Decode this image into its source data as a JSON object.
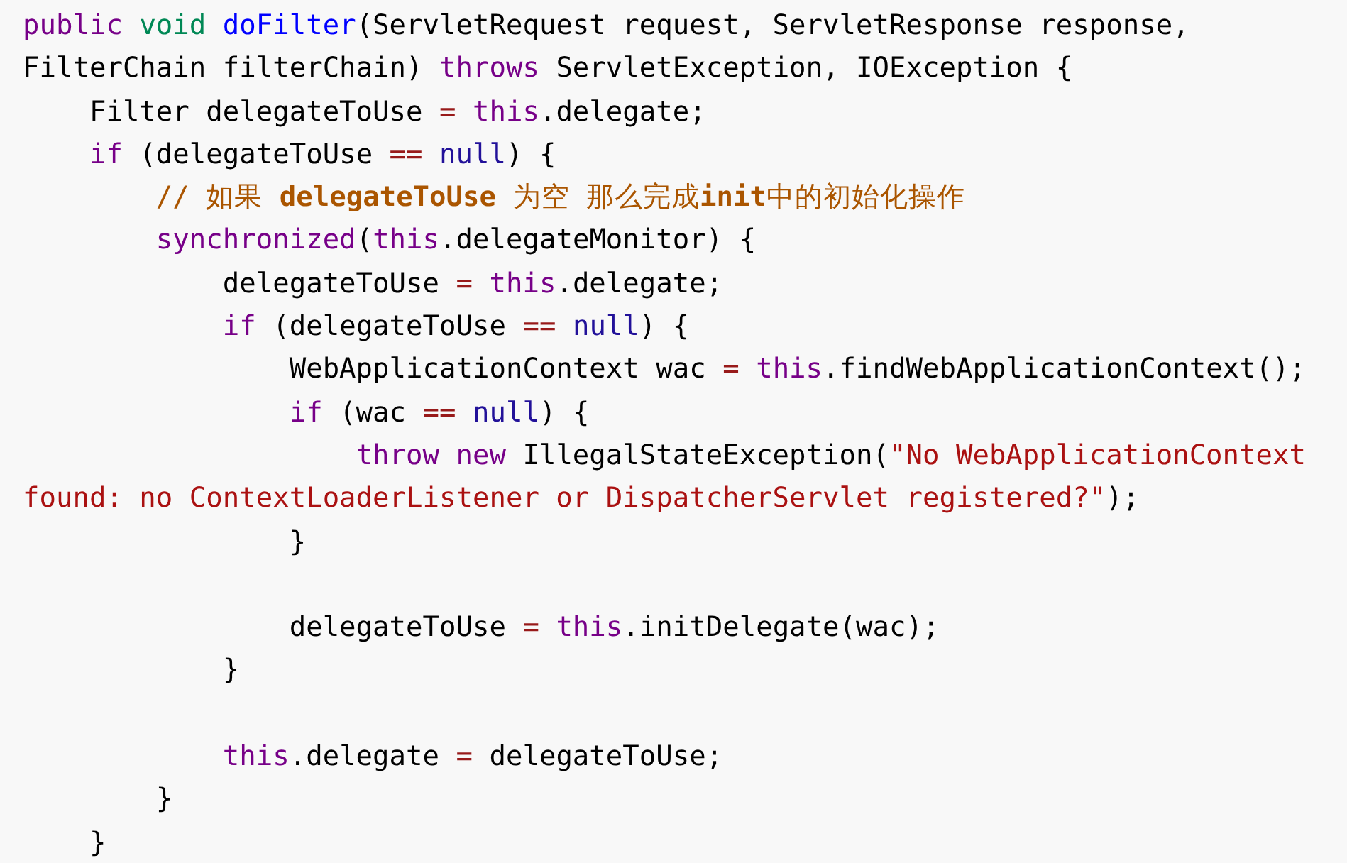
{
  "code_block": {
    "lines": [
      {
        "kind": "code",
        "tokens": [
          {
            "kind": "keyword",
            "text": "public "
          },
          {
            "kind": "type",
            "text": "void "
          },
          {
            "kind": "def",
            "text": "doFilter"
          },
          {
            "kind": "plain",
            "text": "(ServletRequest request, ServletResponse response,"
          }
        ]
      },
      {
        "kind": "code",
        "tokens": [
          {
            "kind": "plain",
            "text": "FilterChain filterChain) "
          },
          {
            "kind": "keyword",
            "text": "throws"
          },
          {
            "kind": "plain",
            "text": " ServletException, IOException {"
          }
        ]
      },
      {
        "kind": "code",
        "tokens": [
          {
            "kind": "plain",
            "text": "    Filter delegateToUse "
          },
          {
            "kind": "operator",
            "text": "= "
          },
          {
            "kind": "keyword",
            "text": "this"
          },
          {
            "kind": "plain",
            "text": ".delegate;"
          }
        ]
      },
      {
        "kind": "code",
        "tokens": [
          {
            "kind": "keyword",
            "text": "    if"
          },
          {
            "kind": "plain",
            "text": " (delegateToUse "
          },
          {
            "kind": "operator",
            "text": "== "
          },
          {
            "kind": "atom",
            "text": "null"
          },
          {
            "kind": "plain",
            "text": ") {"
          }
        ]
      },
      {
        "kind": "code",
        "tokens": [
          {
            "kind": "comment",
            "text": "        // 如果 "
          },
          {
            "kind": "comment-strong",
            "text": "delegateToUse"
          },
          {
            "kind": "comment",
            "text": " 为空 那么完成"
          },
          {
            "kind": "comment-strong",
            "text": "init"
          },
          {
            "kind": "comment",
            "text": "中的初始化操作"
          }
        ]
      },
      {
        "kind": "code",
        "tokens": [
          {
            "kind": "keyword",
            "text": "        synchronized"
          },
          {
            "kind": "plain",
            "text": "("
          },
          {
            "kind": "keyword",
            "text": "this"
          },
          {
            "kind": "plain",
            "text": ".delegateMonitor) {"
          }
        ]
      },
      {
        "kind": "code",
        "tokens": [
          {
            "kind": "plain",
            "text": "            delegateToUse "
          },
          {
            "kind": "operator",
            "text": "= "
          },
          {
            "kind": "keyword",
            "text": "this"
          },
          {
            "kind": "plain",
            "text": ".delegate;"
          }
        ]
      },
      {
        "kind": "code",
        "tokens": [
          {
            "kind": "keyword",
            "text": "            if"
          },
          {
            "kind": "plain",
            "text": " (delegateToUse "
          },
          {
            "kind": "operator",
            "text": "== "
          },
          {
            "kind": "atom",
            "text": "null"
          },
          {
            "kind": "plain",
            "text": ") {"
          }
        ]
      },
      {
        "kind": "code",
        "tokens": [
          {
            "kind": "plain",
            "text": "                WebApplicationContext wac "
          },
          {
            "kind": "operator",
            "text": "= "
          },
          {
            "kind": "keyword",
            "text": "this"
          },
          {
            "kind": "plain",
            "text": ".findWebApplicationContext();"
          }
        ]
      },
      {
        "kind": "code",
        "tokens": [
          {
            "kind": "keyword",
            "text": "                if"
          },
          {
            "kind": "plain",
            "text": " (wac "
          },
          {
            "kind": "operator",
            "text": "== "
          },
          {
            "kind": "atom",
            "text": "null"
          },
          {
            "kind": "plain",
            "text": ") {"
          }
        ]
      },
      {
        "kind": "code",
        "tokens": [
          {
            "kind": "keyword",
            "text": "                    throw new"
          },
          {
            "kind": "plain",
            "text": " IllegalStateException("
          },
          {
            "kind": "string",
            "text": "\"No WebApplicationContext"
          }
        ]
      },
      {
        "kind": "code",
        "tokens": [
          {
            "kind": "string",
            "text": "found: no ContextLoaderListener or DispatcherServlet registered?\""
          },
          {
            "kind": "plain",
            "text": ");"
          }
        ]
      },
      {
        "kind": "code",
        "tokens": [
          {
            "kind": "plain",
            "text": "                }"
          }
        ]
      },
      {
        "kind": "blank"
      },
      {
        "kind": "code",
        "tokens": [
          {
            "kind": "plain",
            "text": "                delegateToUse "
          },
          {
            "kind": "operator",
            "text": "= "
          },
          {
            "kind": "keyword",
            "text": "this"
          },
          {
            "kind": "plain",
            "text": ".initDelegate(wac);"
          }
        ]
      },
      {
        "kind": "code",
        "tokens": [
          {
            "kind": "plain",
            "text": "            }"
          }
        ]
      },
      {
        "kind": "blank"
      },
      {
        "kind": "code",
        "tokens": [
          {
            "kind": "keyword",
            "text": "            this"
          },
          {
            "kind": "plain",
            "text": ".delegate "
          },
          {
            "kind": "operator",
            "text": "= "
          },
          {
            "kind": "plain",
            "text": "delegateToUse;"
          }
        ]
      },
      {
        "kind": "code",
        "tokens": [
          {
            "kind": "plain",
            "text": "        }"
          }
        ]
      },
      {
        "kind": "code",
        "tokens": [
          {
            "kind": "plain",
            "text": "    }"
          }
        ]
      }
    ]
  }
}
